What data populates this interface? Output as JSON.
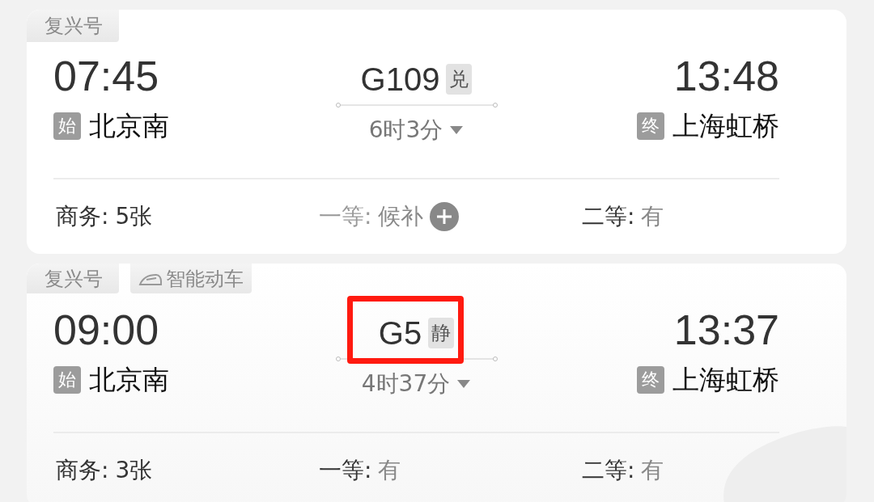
{
  "trains": [
    {
      "tags": [
        {
          "kind": "plain",
          "label": "复兴号"
        }
      ],
      "depart_time": "07:45",
      "depart_badge": "始",
      "depart_station": "北京南",
      "train_no": "G109",
      "train_badge": "兑",
      "duration": "6时3分",
      "arrive_time": "13:48",
      "arrive_badge": "终",
      "arrive_station": "上海虹桥",
      "highlighted": false,
      "seats": [
        {
          "label": "商务:",
          "value": "5张",
          "kind": "count"
        },
        {
          "label": "一等:",
          "value": "候补",
          "kind": "waitlist"
        },
        {
          "label": "二等:",
          "value": "有",
          "kind": "available"
        }
      ]
    },
    {
      "tags": [
        {
          "kind": "plain",
          "label": "复兴号"
        },
        {
          "kind": "smart",
          "label": "智能动车"
        }
      ],
      "depart_time": "09:00",
      "depart_badge": "始",
      "depart_station": "北京南",
      "train_no": "G5",
      "train_badge": "静",
      "duration": "4时37分",
      "arrive_time": "13:37",
      "arrive_badge": "终",
      "arrive_station": "上海虹桥",
      "highlighted": true,
      "seats": [
        {
          "label": "商务:",
          "value": "3张",
          "kind": "count"
        },
        {
          "label": "一等:",
          "value": "有",
          "kind": "available"
        },
        {
          "label": "二等:",
          "value": "有",
          "kind": "available"
        }
      ]
    }
  ]
}
